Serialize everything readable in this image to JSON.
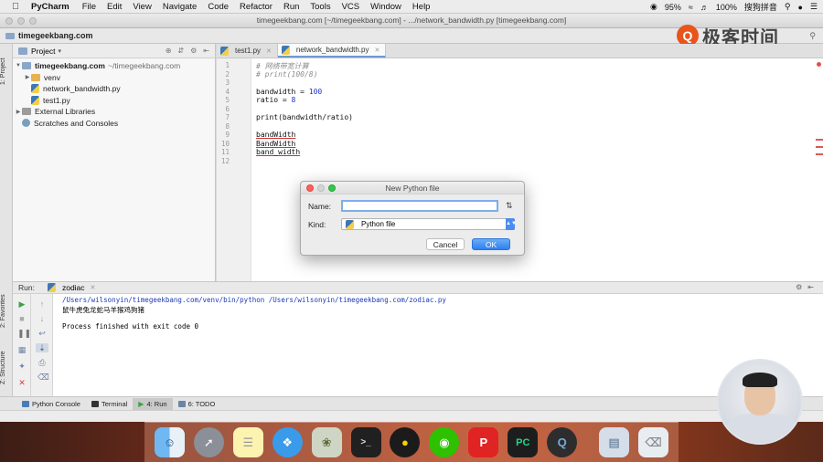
{
  "menubar": {
    "app": "PyCharm",
    "items": [
      "File",
      "Edit",
      "View",
      "Navigate",
      "Code",
      "Refactor",
      "Run",
      "Tools",
      "VCS",
      "Window",
      "Help"
    ],
    "battery_small": "95%",
    "battery": "100%",
    "input_method": "搜狗拼音"
  },
  "window": {
    "title": "timegeekbang.com [~/timegeekbang.com] - .../network_bandwidth.py [timegeekbang.com]"
  },
  "navbar": {
    "breadcrumb": "timegeekbang.com"
  },
  "logo": {
    "text": "极客时间"
  },
  "leftstrip": {
    "project_tab": "1: Project",
    "favorites_tab": "2: Favorites",
    "structure_tab": "Z: Structure"
  },
  "project_panel": {
    "header": "Project",
    "tree": [
      {
        "label": "timegeekbang.com",
        "detail": "~/timegeekbang.com"
      },
      {
        "label": "venv"
      },
      {
        "label": "network_bandwidth.py"
      },
      {
        "label": "test1.py"
      },
      {
        "label": "External Libraries"
      },
      {
        "label": "Scratches and Consoles"
      }
    ]
  },
  "editor": {
    "tabs": [
      {
        "label": "test1.py"
      },
      {
        "label": "network_bandwidth.py"
      }
    ],
    "lines": [
      {
        "n": "1",
        "text": "# 网络带宽计算"
      },
      {
        "n": "2",
        "text": "# print(100/8)"
      },
      {
        "n": "3",
        "text": ""
      },
      {
        "n": "4",
        "text": "bandwidth = ",
        "num": "100"
      },
      {
        "n": "5",
        "text": "ratio = ",
        "num": "8"
      },
      {
        "n": "6",
        "text": ""
      },
      {
        "n": "7",
        "text": "print(bandwidth/ratio)"
      },
      {
        "n": "8",
        "text": ""
      },
      {
        "n": "9",
        "text": "bandWidth"
      },
      {
        "n": "10",
        "text": "BandWidth"
      },
      {
        "n": "11",
        "text": "band_width"
      },
      {
        "n": "12",
        "text": ""
      }
    ]
  },
  "dialog": {
    "title": "New Python file",
    "name_label": "Name:",
    "name_value": "",
    "kind_label": "Kind:",
    "kind_value": "Python file",
    "cancel": "Cancel",
    "ok": "OK"
  },
  "run_panel": {
    "label": "Run:",
    "config": "zodiac",
    "output": [
      "/Users/wilsonyin/timegeekbang.com/venv/bin/python /Users/wilsonyin/timegeekbang.com/zodiac.py",
      "鼠牛虎兔龙蛇马羊猴鸡狗猪",
      "",
      "Process finished with exit code 0"
    ]
  },
  "bottom_tabs": [
    {
      "label": "Python Console"
    },
    {
      "label": "Terminal"
    },
    {
      "label": "4: Run"
    },
    {
      "label": "6: TODO"
    }
  ],
  "colors": {
    "accent": "#2f7ff0",
    "number": "#1f35c8",
    "comment": "#8c8c8c",
    "error_underline": "#d03030",
    "logo": "#e8541b"
  }
}
